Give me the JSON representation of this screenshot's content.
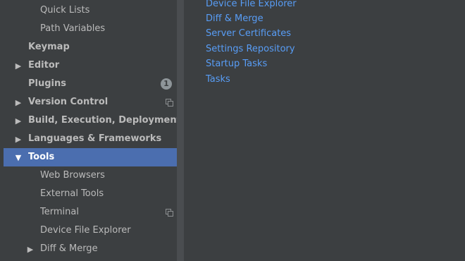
{
  "sidebar": {
    "items": [
      {
        "label": "Quick Lists"
      },
      {
        "label": "Path Variables"
      },
      {
        "label": "Keymap"
      },
      {
        "label": "Editor"
      },
      {
        "label": "Plugins",
        "badge": "1"
      },
      {
        "label": "Version Control"
      },
      {
        "label": "Build, Execution, Deployment"
      },
      {
        "label": "Languages & Frameworks"
      },
      {
        "label": "Tools"
      },
      {
        "label": "Web Browsers"
      },
      {
        "label": "External Tools"
      },
      {
        "label": "Terminal"
      },
      {
        "label": "Device File Explorer"
      },
      {
        "label": "Diff & Merge"
      }
    ]
  },
  "main": {
    "links": [
      {
        "label": "Device File Explorer"
      },
      {
        "label": "Diff & Merge"
      },
      {
        "label": "Server Certificates"
      },
      {
        "label": "Settings Repository"
      },
      {
        "label": "Startup Tasks"
      },
      {
        "label": "Tasks"
      }
    ]
  },
  "colors": {
    "background": "#3c3f41",
    "selection": "#4b6eaf",
    "link": "#589df6",
    "text": "#bbbbbb"
  }
}
